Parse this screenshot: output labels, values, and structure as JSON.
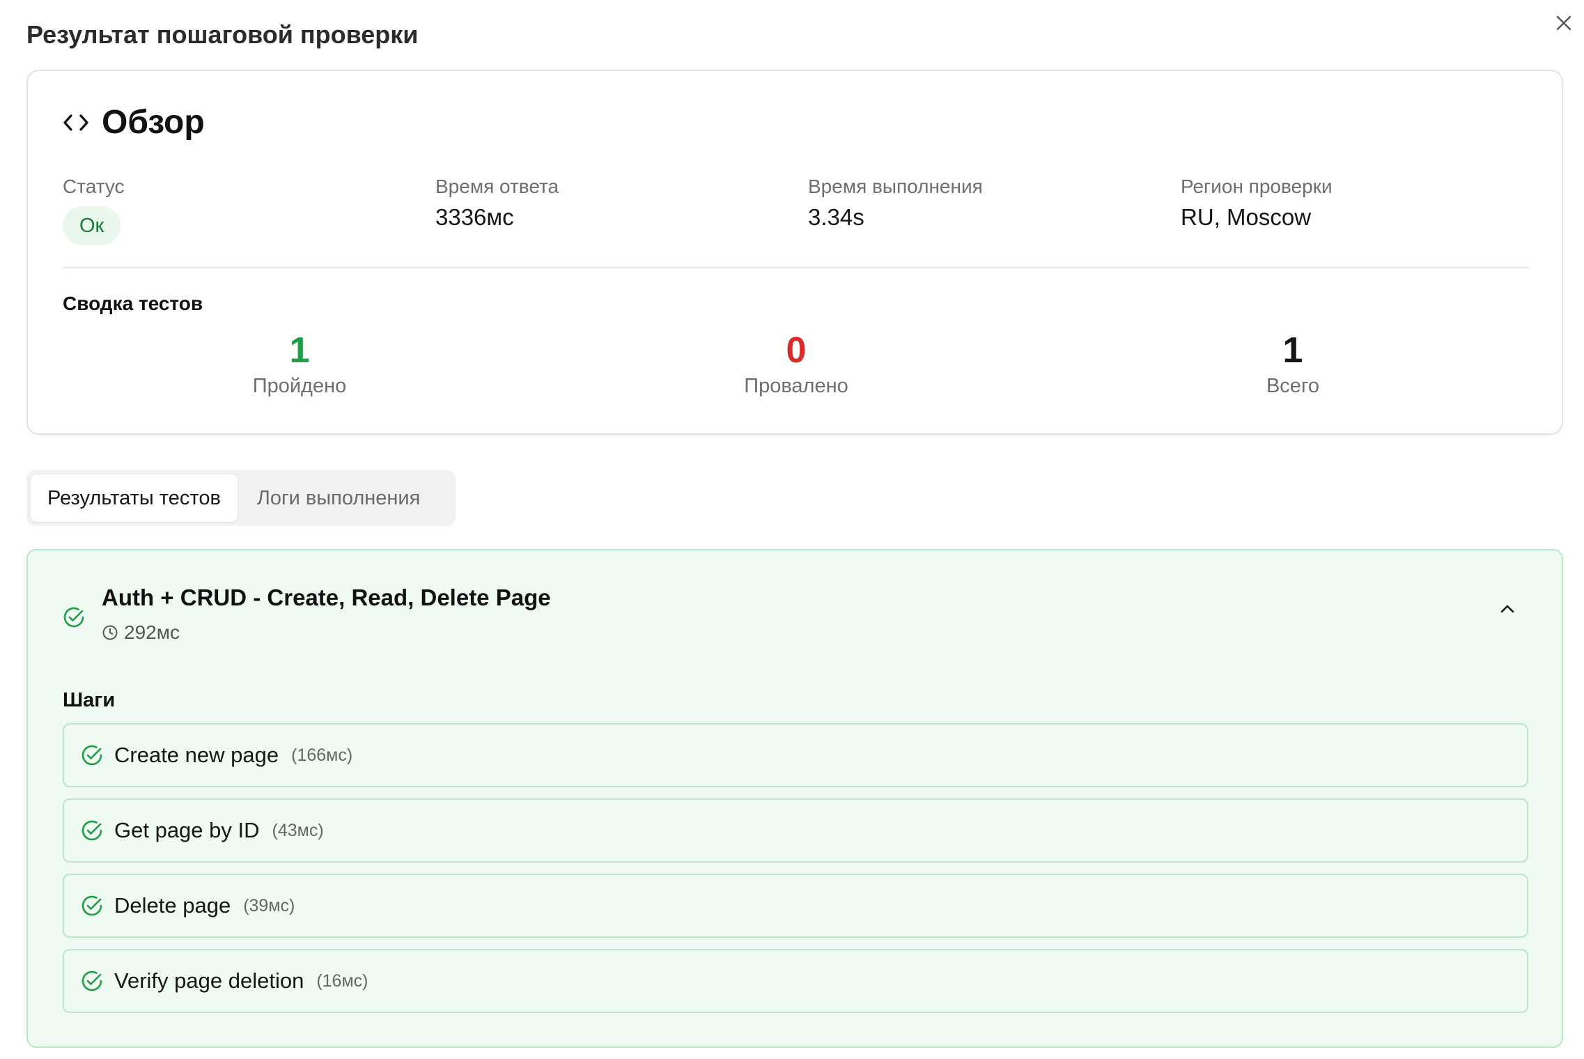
{
  "dialog": {
    "title": "Результат пошаговой проверки"
  },
  "overview": {
    "title": "Обзор",
    "icon": "code-icon",
    "status": {
      "label": "Статус",
      "value": "Ок"
    },
    "response_time": {
      "label": "Время ответа",
      "value": "3336мс"
    },
    "execution_time": {
      "label": "Время выполнения",
      "value": "3.34s"
    },
    "region": {
      "label": "Регион проверки",
      "value": "RU, Moscow"
    }
  },
  "summary": {
    "title": "Сводка тестов",
    "passed": {
      "value": "1",
      "label": "Пройдено",
      "color": "#1f9d47"
    },
    "failed": {
      "value": "0",
      "label": "Провалено",
      "color": "#d92d2d"
    },
    "total": {
      "value": "1",
      "label": "Всего",
      "color": "#161616"
    }
  },
  "tabs": [
    {
      "label": "Результаты тестов",
      "active": true
    },
    {
      "label": "Логи выполнения",
      "active": false
    }
  ],
  "test": {
    "name": "Auth + CRUD - Create, Read, Delete Page",
    "duration": "292мс",
    "steps_title": "Шаги",
    "steps": [
      {
        "name": "Create new page",
        "duration": "(166мс)"
      },
      {
        "name": "Get page by ID",
        "duration": "(43мс)"
      },
      {
        "name": "Delete page",
        "duration": "(39мс)"
      },
      {
        "name": "Verify page deletion",
        "duration": "(16мс)"
      }
    ]
  },
  "colors": {
    "success": "#1f9d47",
    "success_bg": "#effbf2",
    "success_border": "#b8e8c6",
    "danger": "#d92d2d"
  }
}
